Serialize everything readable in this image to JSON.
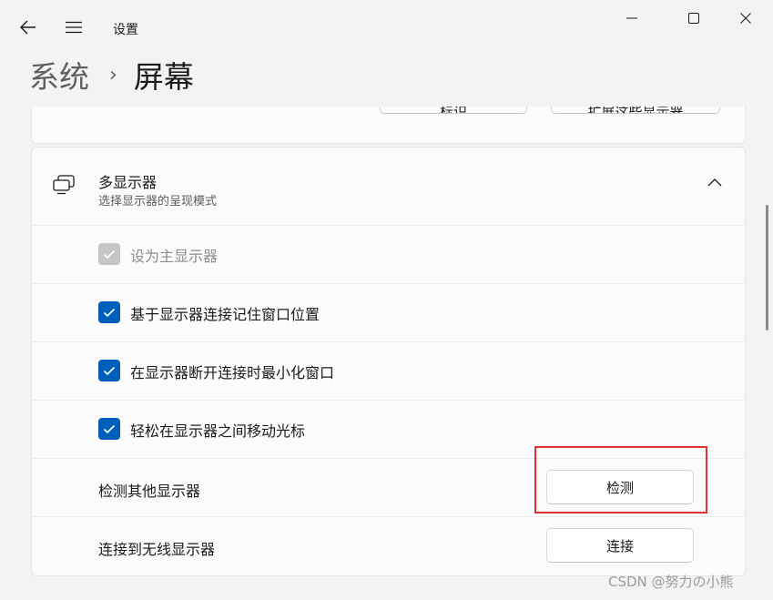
{
  "window": {
    "title": "设置",
    "controls": {
      "minimize": "minimize-icon",
      "maximize": "maximize-icon",
      "close": "close-icon"
    },
    "back_icon": "back-arrow-icon",
    "menu_icon": "hamburger-menu-icon"
  },
  "breadcrumb": {
    "parent": "系统",
    "separator": "›",
    "current": "屏幕"
  },
  "top_card": {
    "button_identify": "标识",
    "button_extend": "扩展这些显示器"
  },
  "multi_display": {
    "icon": "multi-monitor-icon",
    "title": "多显示器",
    "subtitle": "选择显示器的呈现模式",
    "expanded": true,
    "options": [
      {
        "label": "设为主显示器",
        "checked": true,
        "disabled": true
      },
      {
        "label": "基于显示器连接记住窗口位置",
        "checked": true,
        "disabled": false
      },
      {
        "label": "在显示器断开连接时最小化窗口",
        "checked": true,
        "disabled": false
      },
      {
        "label": "轻松在显示器之间移动光标",
        "checked": true,
        "disabled": false
      }
    ],
    "detect": {
      "label": "检测其他显示器",
      "button": "检测"
    },
    "connect": {
      "label": "连接到无线显示器",
      "button": "连接"
    }
  },
  "watermark": "CSDN @努力の小熊",
  "colors": {
    "accent": "#005fb8",
    "highlight_box": "#e0302f",
    "disabled_check": "#c5c5c5"
  }
}
